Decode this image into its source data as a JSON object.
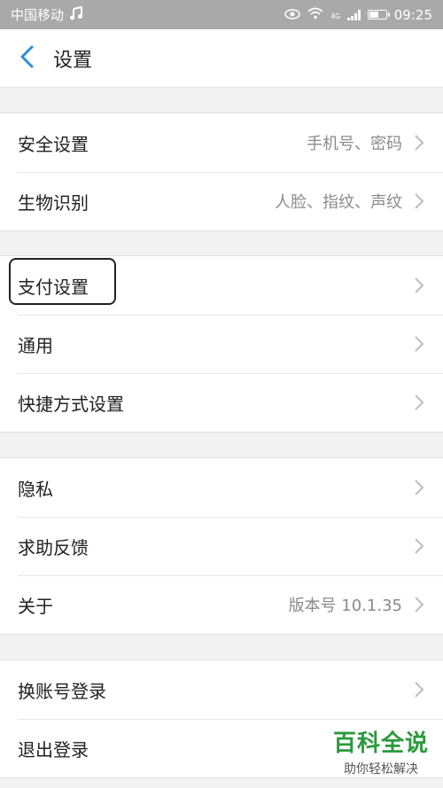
{
  "status_bar": {
    "carrier": "中国移动",
    "network": "4G",
    "time": "09:25",
    "battery_level": 0.6
  },
  "header": {
    "title": "设置"
  },
  "groups": [
    {
      "rows": [
        {
          "label": "安全设置",
          "value": "手机号、密码"
        },
        {
          "label": "生物识别",
          "value": "人脸、指纹、声纹"
        }
      ]
    },
    {
      "rows": [
        {
          "label": "支付设置",
          "value": ""
        },
        {
          "label": "通用",
          "value": ""
        },
        {
          "label": "快捷方式设置",
          "value": ""
        }
      ]
    },
    {
      "rows": [
        {
          "label": "隐私",
          "value": ""
        },
        {
          "label": "求助反馈",
          "value": ""
        },
        {
          "label": "关于",
          "value": "版本号 10.1.35"
        }
      ]
    },
    {
      "rows": [
        {
          "label": "换账号登录",
          "value": ""
        },
        {
          "label": "退出登录",
          "value": ""
        }
      ]
    }
  ],
  "watermark": {
    "title": "百科全说",
    "subtitle": "助你轻松解决"
  },
  "colors": {
    "status_bar_bg": "#a9a9a9",
    "accent_blue": "#2a8fd6",
    "watermark_green": "#2a9a3c",
    "chevron_gray": "#bdbdbd"
  }
}
